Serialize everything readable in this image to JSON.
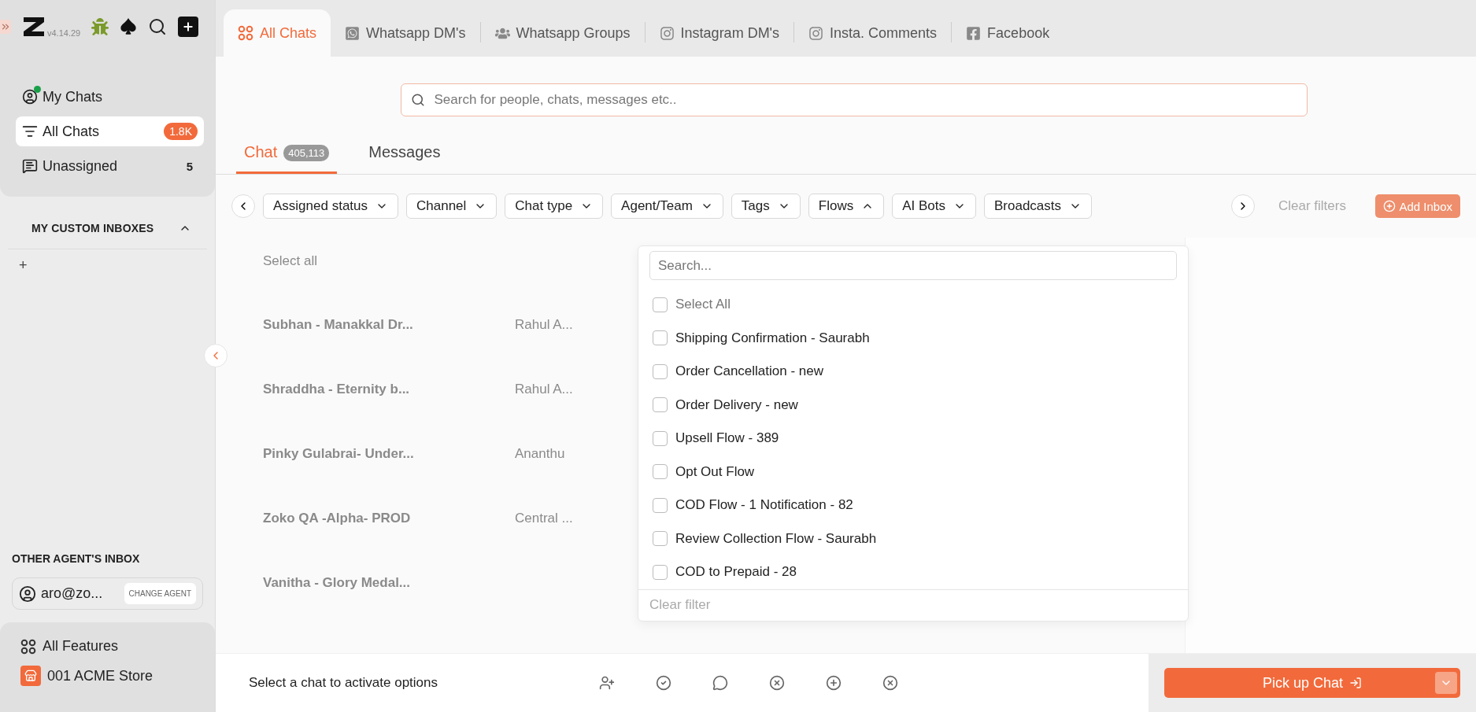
{
  "sidebar": {
    "version": "v4.14.29",
    "nav": [
      {
        "label": "My Chats",
        "kind": "mine",
        "selected": false,
        "online": true
      },
      {
        "label": "All Chats",
        "kind": "all",
        "selected": true,
        "badge": "1.8K"
      },
      {
        "label": "Unassigned",
        "kind": "unassigned",
        "selected": false,
        "count": "5"
      }
    ],
    "custom_inboxes": {
      "title": "MY CUSTOM INBOXES",
      "expanded": true,
      "add": "+"
    },
    "other_agent": {
      "title": "OTHER AGENT'S INBOX",
      "agent": "aro@zo...",
      "button": "CHANGE AGENT"
    },
    "footer": [
      {
        "label": "All Features",
        "kind": "features"
      },
      {
        "label": "001 ACME Store",
        "kind": "store"
      }
    ]
  },
  "tabs": [
    {
      "label": "All Chats",
      "kind": "grid",
      "selected": true
    },
    {
      "label": "Whatsapp DM's",
      "kind": "whatsapp",
      "selected": false
    },
    {
      "label": "Whatsapp Groups",
      "kind": "group",
      "selected": false
    },
    {
      "label": "Instagram DM's",
      "kind": "instagram",
      "selected": false
    },
    {
      "label": "Insta. Comments",
      "kind": "instagram",
      "selected": false
    },
    {
      "label": "Facebook",
      "kind": "facebook",
      "selected": false
    }
  ],
  "search": {
    "placeholder": "Search for people, chats, messages etc.."
  },
  "view_tabs": [
    {
      "label": "Chat",
      "count": "405,113",
      "selected": true
    },
    {
      "label": "Messages",
      "selected": false
    }
  ],
  "filters": [
    {
      "label": "Assigned status",
      "expanded": false
    },
    {
      "label": "Channel",
      "expanded": false
    },
    {
      "label": "Chat type",
      "expanded": false
    },
    {
      "label": "Agent/Team",
      "expanded": false
    },
    {
      "label": "Tags",
      "expanded": false
    },
    {
      "label": "Flows",
      "expanded": true
    },
    {
      "label": "AI Bots",
      "expanded": false
    },
    {
      "label": "Broadcasts",
      "expanded": false
    }
  ],
  "clear_filters": "Clear filters",
  "add_inbox": "Add Inbox",
  "dropdown": {
    "placeholder": "Search...",
    "select_all": {
      "label": "Select All",
      "checked": false
    },
    "options": [
      {
        "label": "Shipping Confirmation - Saurabh",
        "checked": false
      },
      {
        "label": "Order Cancellation - new",
        "checked": false
      },
      {
        "label": "Order Delivery - new",
        "checked": false
      },
      {
        "label": "Upsell Flow - 389",
        "checked": false
      },
      {
        "label": "Opt Out Flow",
        "checked": false
      },
      {
        "label": "COD Flow - 1 Notification - 82",
        "checked": false
      },
      {
        "label": "Review Collection Flow - Saurabh",
        "checked": false
      },
      {
        "label": "COD to Prepaid - 28",
        "checked": false
      }
    ],
    "clear": "Clear filter"
  },
  "chat_list": {
    "select_all": "Select all",
    "rows": [
      {
        "name": "Subhan - Manakkal Dr...",
        "agent": "Rahul A..."
      },
      {
        "name": "Shraddha - Eternity b...",
        "agent": "Rahul A..."
      },
      {
        "name": "Pinky Gulabrai- Under...",
        "agent": "Ananthu"
      },
      {
        "name": "Zoko QA -Alpha- PROD",
        "agent": "Central ..."
      },
      {
        "name": "Vanitha - Glory Medal..."
      }
    ]
  },
  "action_bar": {
    "hint": "Select a chat to activate options",
    "primary": "Pick up Chat"
  }
}
